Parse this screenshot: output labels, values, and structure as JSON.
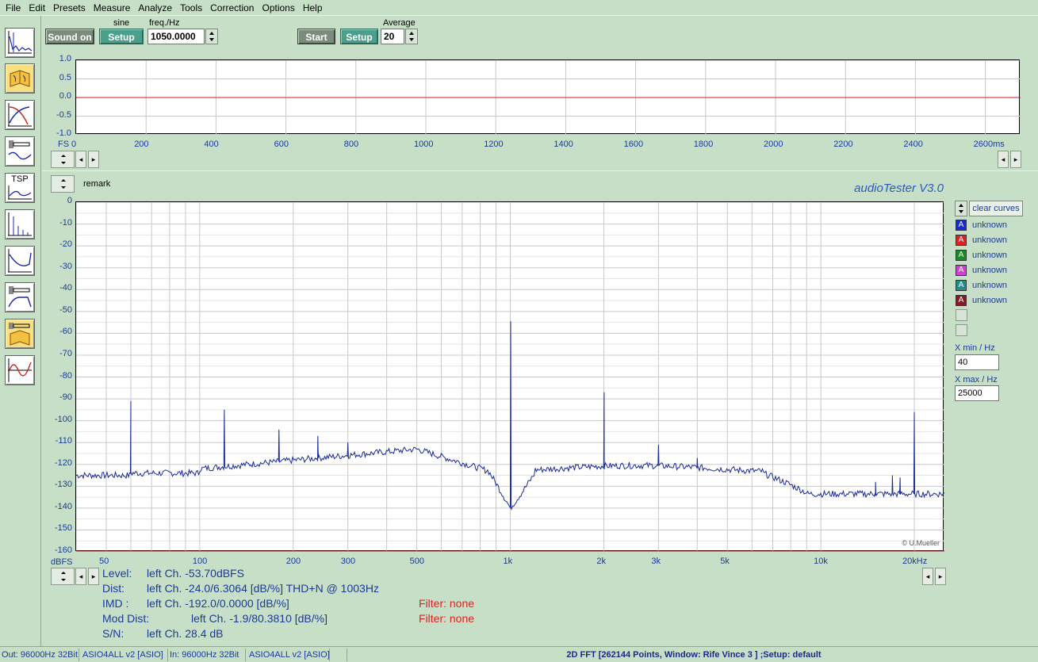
{
  "menu": [
    "File",
    "Edit",
    "Presets",
    "Measure",
    "Analyze",
    "Tools",
    "Correction",
    "Options",
    "Help"
  ],
  "generator": {
    "sound_on_label": "Sound on",
    "waveform_label": "sine",
    "setup_label": "Setup",
    "freq_label": "freq./Hz",
    "freq_value": "1050.0000"
  },
  "measure": {
    "start_label": "Start",
    "setup_label": "Setup",
    "average_label": "Average",
    "average_value": "20"
  },
  "left_tools": [
    "scope-tool-icon",
    "book-tool-icon",
    "bode-tool-icon",
    "speaker-tool-icon",
    "tsp-tool-icon",
    "fft-tool-icon",
    "impedance-tool-icon",
    "speaker-response-tool-icon",
    "speaker-book-tool-icon",
    "sweep-tool-icon"
  ],
  "tsp_label": "TSP",
  "scope": {
    "y_ticks": [
      "1.0",
      "0.5",
      "0.0",
      "-0.5",
      "-1.0"
    ],
    "x_ticks": [
      "0",
      "200",
      "400",
      "600",
      "800",
      "1000",
      "1200",
      "1400",
      "1600",
      "1800",
      "2000",
      "2200",
      "2400",
      "2600ms"
    ],
    "fs_label": "FS"
  },
  "fft": {
    "remark_label": "remark",
    "title": "audioTester  V3.0",
    "copyright": "© U.Mueller",
    "y_unit": "dBFS",
    "y_ticks": [
      "0",
      "-10",
      "-20",
      "-30",
      "-40",
      "-50",
      "-60",
      "-70",
      "-80",
      "-90",
      "-100",
      "-110",
      "-120",
      "-130",
      "-140",
      "-150",
      "-160"
    ],
    "x_ticks": [
      "50",
      "100",
      "200",
      "300",
      "500",
      "1k",
      "2k",
      "3k",
      "5k",
      "10k",
      "20kHz"
    ],
    "clear_curves_label": "clear curves",
    "legend": [
      {
        "letter": "A",
        "label": "unknown",
        "color": "#1a2acc"
      },
      {
        "letter": "A",
        "label": "unknown",
        "color": "#e02020"
      },
      {
        "letter": "A",
        "label": "unknown",
        "color": "#1a8a2a"
      },
      {
        "letter": "A",
        "label": "unknown",
        "color": "#d040d0"
      },
      {
        "letter": "A",
        "label": "unknown",
        "color": "#2a8a8a"
      },
      {
        "letter": "A",
        "label": "unknown",
        "color": "#8a1a2a"
      }
    ],
    "xmin_label": "X min / Hz",
    "xmin_value": "40",
    "xmax_label": "X max / Hz",
    "xmax_value": "25000"
  },
  "readouts": {
    "level_label": "Level:",
    "level_value": "left Ch. -53.70dBFS",
    "dist_label": "Dist:",
    "dist_value": "left Ch. -24.0/6.3064 [dB/%] THD+N  @ 1003Hz",
    "imd_label": "IMD  :",
    "imd_value": "left Ch. -192.0/0.0000 [dB/%]",
    "imd_filter": "Filter: none",
    "moddist_label": "Mod Dist:",
    "moddist_value": "left Ch. -1.9/80.3810 [dB/%]",
    "moddist_filter": "Filter: none",
    "sn_label": "S/N:",
    "sn_value": "left Ch. 28.4 dB"
  },
  "status": {
    "out": "Out: 96000Hz 32Bit",
    "out_driver": "ASIO4ALL v2 [ASIO]",
    "in": "In: 96000Hz 32Bit",
    "in_driver": "ASIO4ALL v2 [ASIO]",
    "info": "2D FFT [262144 Points, Window: Rife Vince 3 ] ;Setup:  default"
  },
  "colors": {
    "curve": "#1a2a9a",
    "zero_line": "#c02020",
    "axis_text": "#1a3a9a",
    "background": "#c7dfc7"
  }
}
